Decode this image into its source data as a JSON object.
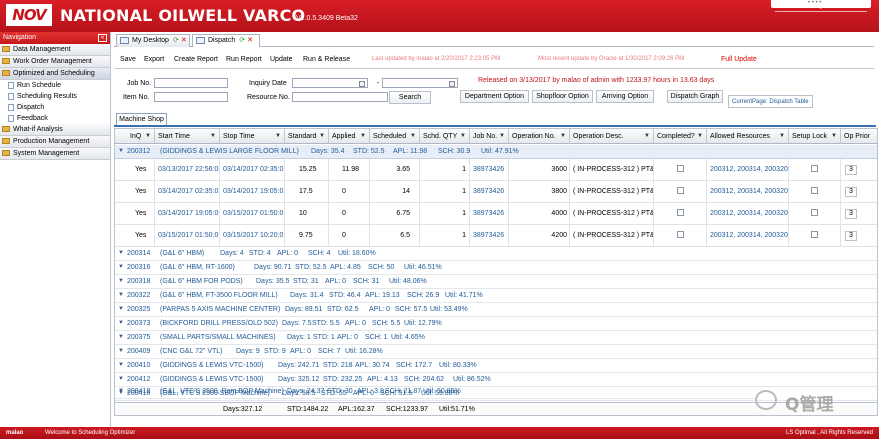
{
  "app": {
    "logo": "NOV",
    "brand": "NATIONAL OILWELL VARCO",
    "version": "V1.0.5.3409 Beta32",
    "password_label": "Password",
    "logout_label": "Logout"
  },
  "nav": {
    "title": "Navigation",
    "collapse": "«",
    "groups": [
      {
        "label": "Data Management"
      },
      {
        "label": "Work Order Management"
      },
      {
        "label": "Optimized and Scheduling"
      },
      {
        "label": "What-if Analysis"
      },
      {
        "label": "Production Management"
      },
      {
        "label": "System Management"
      }
    ],
    "subitems": [
      {
        "label": "Run Schedule"
      },
      {
        "label": "Scheduling Results"
      },
      {
        "label": "Dispatch"
      },
      {
        "label": "Feedback"
      }
    ]
  },
  "tabs": [
    {
      "label": "My Desktop",
      "refresh": "⟳",
      "close": "✕"
    },
    {
      "label": "Dispatch",
      "refresh": "⟳",
      "close": "✕"
    }
  ],
  "toolbar": {
    "save": "Save",
    "export": "Export",
    "create_report": "Create Report",
    "run_report": "Run Report",
    "update": "Update",
    "run_release": "Run & Release",
    "last_updated": "Last updated by malao at 2/20/2017 2:23:05 PM",
    "recent_update": "Most recent update by Oracle at 1/30/2017 2:09:26 PM",
    "full_update": "Full Update"
  },
  "filters": {
    "job_no": "Job No.",
    "item_no": "Item No.",
    "inquiry_date": "Inquiry Date",
    "resource_no": "Resource No.",
    "date_sep": "-",
    "search": "Search",
    "released": "Released on 3/13/2017 by malao of admin with 1233.97 hours in 13.63 days",
    "department_option": "Department Option",
    "shopfloor_option": "Shopfloor Option",
    "arriving_option": "Arriving Option",
    "dispatch_graph": "Dispatch Graph",
    "current_page": "CurrentPage: Dispatch Table"
  },
  "grid": {
    "tab": "Machine Shop",
    "columns": [
      "InQ",
      "Start Time",
      "Stop Time",
      "Standard",
      "Applied",
      "Scheduled",
      "Schd. QTY",
      "Job No.",
      "Operation No.",
      "Operation Desc.",
      "Completed?",
      "Allowed Resources",
      "Setup Lock",
      "Op Prior"
    ],
    "filter_icon": "▼",
    "expanded_group": {
      "code": "200312",
      "name": "(GIDDINGS & LEWIS LARGE FLOOR MILL)",
      "days": "Days: 35.4",
      "std": "STD: 52.5",
      "apl": "APL: 11.98",
      "sch": "SCH: 30.9",
      "util": "Util: 47.91%"
    },
    "rows": [
      {
        "inq": "Yes",
        "start": "03/13/2017 22:56:02",
        "stop": "03/14/2017 02:35:01",
        "standard": "15.25",
        "applied": "11.98",
        "scheduled": "3.65",
        "qty": "1",
        "job": "38973426",
        "op_no": "3600",
        "op_desc": "( IN-PROCESS-312 ) PT&I",
        "resources": "200312, 200314, 200320",
        "prior": "3"
      },
      {
        "inq": "Yes",
        "start": "03/14/2017 02:35:01",
        "stop": "03/14/2017 19:05:01",
        "standard": "17.5",
        "applied": "0",
        "scheduled": "14",
        "qty": "1",
        "job": "38973426",
        "op_no": "3800",
        "op_desc": "( IN-PROCESS-312 ) PT&I",
        "resources": "200312, 200314, 200320",
        "prior": "3"
      },
      {
        "inq": "Yes",
        "start": "03/14/2017 19:05:01",
        "stop": "03/15/2017 01:50:01",
        "standard": "10",
        "applied": "0",
        "scheduled": "6.75",
        "qty": "1",
        "job": "38973426",
        "op_no": "4000",
        "op_desc": "( IN-PROCESS-312 ) PT&I",
        "resources": "200312, 200314, 200320",
        "prior": "3"
      },
      {
        "inq": "Yes",
        "start": "03/15/2017 01:50:01",
        "stop": "03/15/2017 10:20:01",
        "standard": "9.75",
        "applied": "0",
        "scheduled": "6.5",
        "qty": "1",
        "job": "38973426",
        "op_no": "4200",
        "op_desc": "( IN-PROCESS-312 ) PT&I",
        "resources": "200312, 200314, 200320",
        "prior": "3"
      }
    ],
    "groups": [
      {
        "code": "200314",
        "name": "(G&L 6\" HBM)",
        "days": "Days: 4",
        "std": "STD: 4",
        "apl": "APL: 0",
        "sch": "SCH: 4",
        "util": "Util: 18.60%"
      },
      {
        "code": "200316",
        "name": "(G&L 6\" HBM, RT-1600)",
        "days": "Days: 90.71",
        "std": "STD: 52.5",
        "apl": "APL: 4.85",
        "sch": "SCH: 50",
        "util": "Util: 46.51%"
      },
      {
        "code": "200318",
        "name": "(G&L 6\" HBM FOR PODS)",
        "days": "Days: 35.5",
        "std": "STD: 31",
        "apl": "APL: 0",
        "sch": "SCH: 31",
        "util": "Util: 48.06%"
      },
      {
        "code": "200322",
        "name": "(G&L 6\" HBM, FT-3500 FLOOR MILL)",
        "days": "Days: 31.4",
        "std": "STD: 46.4",
        "apl": "APL: 19.13",
        "sch": "SCH: 26.9",
        "util": "Util: 41.71%"
      },
      {
        "code": "200325",
        "name": "(PARPAS 5 AXIS MACHINE CENTER)",
        "days": "Days: 89.51",
        "std": "STD: 62.5",
        "apl": "APL: 0",
        "sch": "SCH: 57.5",
        "util": "Util: 53.49%"
      },
      {
        "code": "200373",
        "name": "(BICKFORD DRILL PRESS/OLD 502)",
        "days": "Days: 7.5",
        "std": "STD: 5.5",
        "apl": "APL: 0",
        "sch": "SCH: 5.5",
        "util": "Util: 12.79%"
      },
      {
        "code": "200375",
        "name": "(SMALL PARTS/SMALL MACHINES)",
        "days": "Days: 1",
        "std": "STD: 1",
        "apl": "APL: 0",
        "sch": "SCH: 1",
        "util": "Util: 4.65%"
      },
      {
        "code": "200409",
        "name": "(CNC G&L 72\" VTL)",
        "days": "Days: 9",
        "std": "STD: 9",
        "apl": "APL: 0",
        "sch": "SCH: 7",
        "util": "Util: 16.28%"
      },
      {
        "code": "200410",
        "name": "(GIDDINGS & LEWIS VTC-1500)",
        "days": "Days: 242.71",
        "std": "STD: 218",
        "apl": "APL: 30.74",
        "sch": "SCH: 172.7",
        "util": "Util: 80.33%"
      },
      {
        "code": "200412",
        "name": "(GIDDINGS & LEWIS VTC-1500)",
        "days": "Days: 325.12",
        "std": "STD: 232.25",
        "apl": "APL: 4.13",
        "sch": "SCH: 204.62",
        "util": "Util: 86.52%"
      },
      {
        "code": "200416",
        "name": "(G&L, VTC'S 2500 SBOP Machine)",
        "days": "Days: 58.5",
        "std": "STD: 55",
        "apl": "APL: 0",
        "sch": "SCH: 51.5",
        "util": "Util: 59.88%"
      },
      {
        "code": "200418",
        "name": "(G&L, VTC'S 2500, Ram BOP Machine)",
        "days": "Days: 24.37",
        "std": "STD: 30",
        "apl": "APL: 3.8",
        "sch": "SCH: 21.87",
        "util": "Util: 50.85%"
      }
    ],
    "totals": {
      "days": "Days:327.12",
      "std": "STD:1484.22",
      "apl": "APL:162.37",
      "sch": "SCH:1233.97",
      "util": "Util:51.71%"
    }
  },
  "status": {
    "logo": "malao",
    "message": "Welcome to Scheduling Optimizer",
    "copyright": "LS Optimal , All Rights Reserved"
  },
  "watermark": {
    "text": "Q管理"
  }
}
